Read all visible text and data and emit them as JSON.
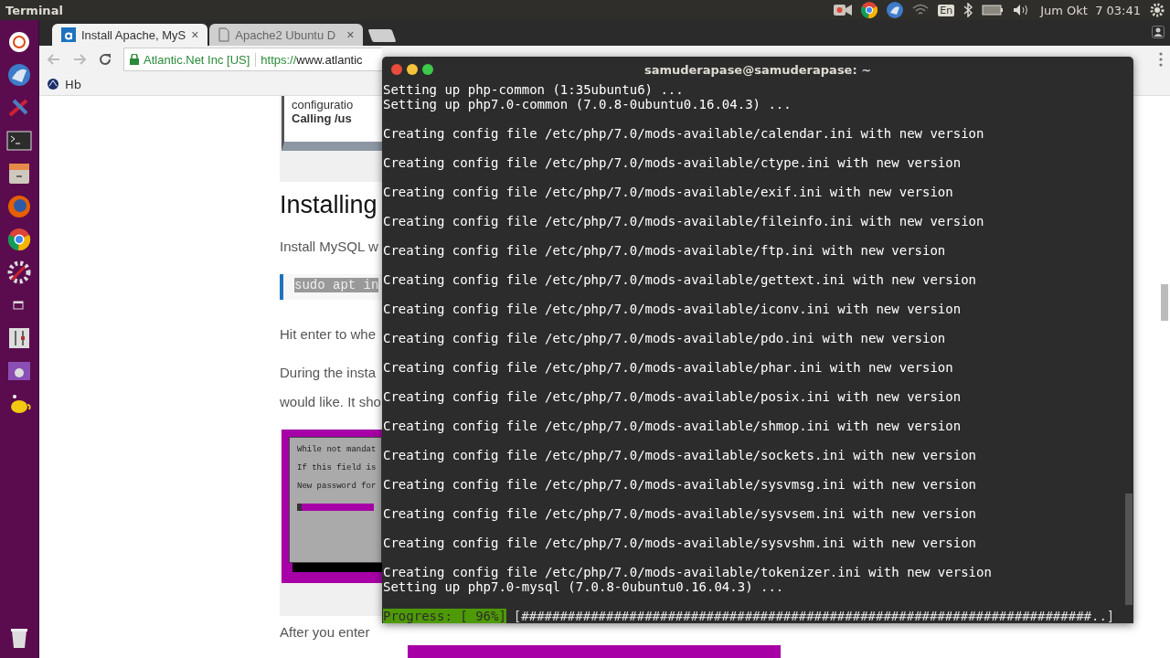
{
  "top_bar": {
    "app_title": "Terminal",
    "keyboard": "En",
    "clock": "Jum Okt  7 03:41"
  },
  "browser": {
    "tabs": [
      {
        "title": "Install Apache, MyS",
        "close": "×",
        "selected": true
      },
      {
        "title": "Apache2 Ubuntu D",
        "close": "×",
        "selected": false
      }
    ],
    "site_identity": "Atlantic.Net Inc [US]",
    "url_scheme": "https://",
    "url_rest": "www.atlantic",
    "bookmarks": [
      {
        "label": "Hb"
      }
    ],
    "page": {
      "snippet_lines": [
        "configuratio",
        "Calling /us"
      ],
      "heading": "Installing",
      "intro": "Install MySQL w",
      "code": "sudo apt in",
      "para_1": "Hit enter to whe",
      "para_2": [
        "During the insta",
        "would like. It sho"
      ],
      "dialog_lines": [
        "While not mandat",
        "If this field is",
        "New password for"
      ],
      "para_3": "After you enter"
    }
  },
  "terminal": {
    "title": "samuderapase@samuderapase: ~",
    "lines": [
      {
        "kind": "setup",
        "text": "Setting up php-common (1:35ubuntu6) ..."
      },
      {
        "kind": "setup",
        "text": "Setting up php7.0-common (7.0.8-0ubuntu0.16.04.3) ..."
      },
      {
        "kind": "config",
        "text": "Creating config file /etc/php/7.0/mods-available/calendar.ini with new version"
      },
      {
        "kind": "config",
        "text": "Creating config file /etc/php/7.0/mods-available/ctype.ini with new version"
      },
      {
        "kind": "config",
        "text": "Creating config file /etc/php/7.0/mods-available/exif.ini with new version"
      },
      {
        "kind": "config",
        "text": "Creating config file /etc/php/7.0/mods-available/fileinfo.ini with new version"
      },
      {
        "kind": "config",
        "text": "Creating config file /etc/php/7.0/mods-available/ftp.ini with new version"
      },
      {
        "kind": "config",
        "text": "Creating config file /etc/php/7.0/mods-available/gettext.ini with new version"
      },
      {
        "kind": "config",
        "text": "Creating config file /etc/php/7.0/mods-available/iconv.ini with new version"
      },
      {
        "kind": "config",
        "text": "Creating config file /etc/php/7.0/mods-available/pdo.ini with new version"
      },
      {
        "kind": "config",
        "text": "Creating config file /etc/php/7.0/mods-available/phar.ini with new version"
      },
      {
        "kind": "config",
        "text": "Creating config file /etc/php/7.0/mods-available/posix.ini with new version"
      },
      {
        "kind": "config",
        "text": "Creating config file /etc/php/7.0/mods-available/shmop.ini with new version"
      },
      {
        "kind": "config",
        "text": "Creating config file /etc/php/7.0/mods-available/sockets.ini with new version"
      },
      {
        "kind": "config",
        "text": "Creating config file /etc/php/7.0/mods-available/sysvmsg.ini with new version"
      },
      {
        "kind": "config",
        "text": "Creating config file /etc/php/7.0/mods-available/sysvsem.ini with new version"
      },
      {
        "kind": "config",
        "text": "Creating config file /etc/php/7.0/mods-available/sysvshm.ini with new version"
      },
      {
        "kind": "config",
        "text": "Creating config file /etc/php/7.0/mods-available/tokenizer.ini with new version"
      },
      {
        "kind": "setup",
        "text": "Setting up php7.0-mysql (7.0.8-0ubuntu0.16.04.3) ..."
      }
    ],
    "progress_label": "Progress: [ 96%]",
    "progress_bar": "[##########################################################################..]"
  }
}
